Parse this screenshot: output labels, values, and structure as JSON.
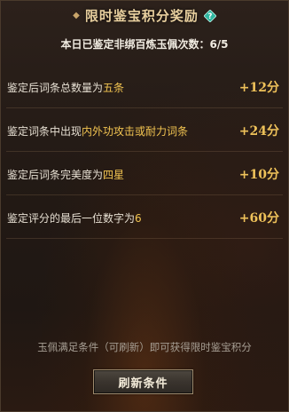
{
  "header": {
    "title": "限时鉴宝积分奖励",
    "deco_left": "◆",
    "deco_right": "◆"
  },
  "subtitle": "本日已鉴定非绑百炼玉佩次数：6/5",
  "rows": [
    {
      "text_prefix": "鉴定后词条总数量为",
      "highlight": "五条",
      "text_suffix": "",
      "score": "+12分"
    },
    {
      "text_prefix": "鉴定词条中出现",
      "highlight": "内外功攻击或耐力词条",
      "text_suffix": "",
      "score": "+24分"
    },
    {
      "text_prefix": "鉴定后词条完美度为",
      "highlight": "四星",
      "text_suffix": "",
      "score": "+10分"
    },
    {
      "text_prefix": "鉴定评分的最后一位数字为",
      "highlight": "6",
      "text_suffix": "",
      "score": "+60分"
    }
  ],
  "footer_note": "玉佩满足条件（可刷新）即可获得限时鉴宝积分",
  "refresh_button": {
    "label": "刷新条件"
  },
  "colors": {
    "highlight": "#f2c451",
    "score": "#efc25a",
    "title": "#e8cf9e",
    "help_icon": "#2fb7a1"
  },
  "icons": {
    "help": "question-diamond-icon"
  }
}
